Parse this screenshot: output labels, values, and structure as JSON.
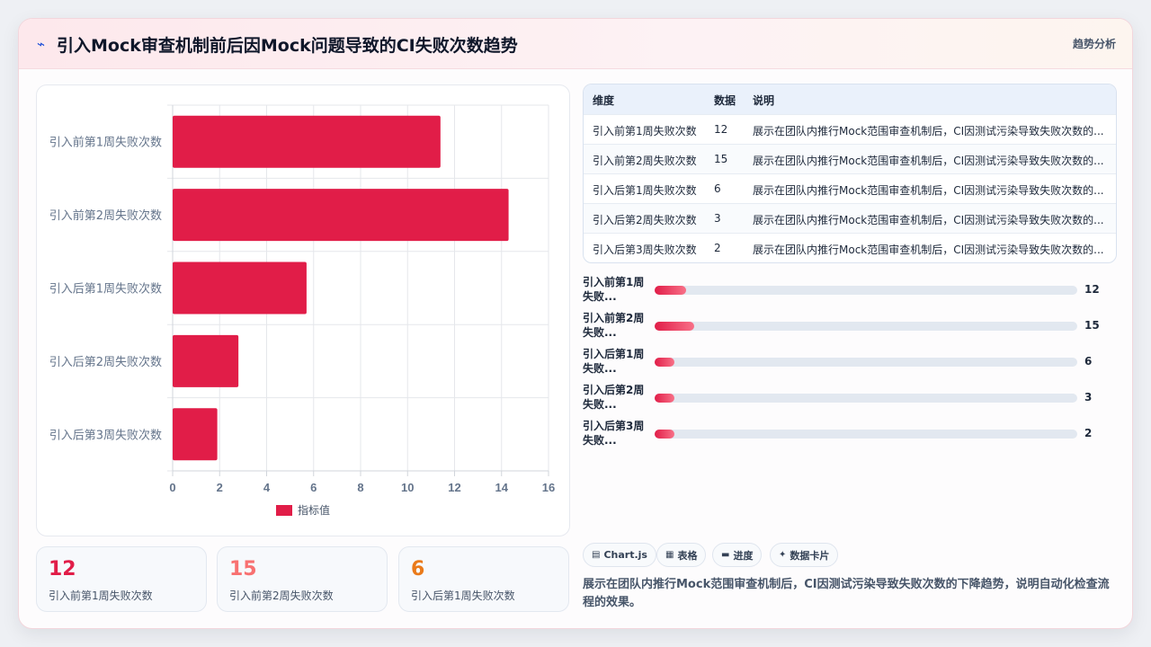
{
  "header": {
    "icon": "line-chart-icon",
    "title": "引入Mock审查机制前后因Mock问题导致的CI失败次数趋势",
    "link": "趋势分析"
  },
  "colors": {
    "accent": "#e11d48",
    "stat1": "#e11d48",
    "stat2": "#f87171",
    "stat3": "#ea7a1a"
  },
  "chart_data": {
    "type": "bar",
    "orientation": "horizontal",
    "categories": [
      "引入前第1周失败次数",
      "引入前第2周失败次数",
      "引入后第1周失败次数",
      "引入后第2周失败次数",
      "引入后第3周失败次数"
    ],
    "series": [
      {
        "name": "指标值",
        "values": [
          11.4,
          14.3,
          5.7,
          2.8,
          1.9
        ],
        "color": "#e11d48"
      }
    ],
    "xlim": [
      0,
      16
    ],
    "xticks": [
      "0",
      "2",
      "4",
      "6",
      "8",
      "10",
      "12",
      "14",
      "16"
    ],
    "grid": true,
    "legend": "bottom"
  },
  "stats": [
    {
      "value": "12",
      "label": "引入前第1周失败次数"
    },
    {
      "value": "15",
      "label": "引入前第2周失败次数"
    },
    {
      "value": "6",
      "label": "引入后第1周失败次数"
    }
  ],
  "table": {
    "headers": [
      "维度",
      "数据",
      "说明"
    ],
    "rows": [
      {
        "dim": "引入前第1周失败次数",
        "value": "12",
        "note": "展示在团队内推行Mock范围审查机制后，CI因测试污染导致失败次数的..."
      },
      {
        "dim": "引入前第2周失败次数",
        "value": "15",
        "note": "展示在团队内推行Mock范围审查机制后，CI因测试污染导致失败次数的..."
      },
      {
        "dim": "引入后第1周失败次数",
        "value": "6",
        "note": "展示在团队内推行Mock范围审查机制后，CI因测试污染导致失败次数的..."
      },
      {
        "dim": "引入后第2周失败次数",
        "value": "3",
        "note": "展示在团队内推行Mock范围审查机制后，CI因测试污染导致失败次数的..."
      },
      {
        "dim": "引入后第3周失败次数",
        "value": "2",
        "note": "展示在团队内推行Mock范围审查机制后，CI因测试污染导致失败次数的..."
      }
    ]
  },
  "progress": [
    {
      "label": "引入前第1周失败...",
      "value": "12",
      "fraction": 0.075
    },
    {
      "label": "引入前第2周失败...",
      "value": "15",
      "fraction": 0.094
    },
    {
      "label": "引入后第1周失败...",
      "value": "6",
      "fraction": 0.047
    },
    {
      "label": "引入后第2周失败...",
      "value": "3",
      "fraction": 0.047
    },
    {
      "label": "引入后第3周失败...",
      "value": "2",
      "fraction": 0.047
    }
  ],
  "tags": [
    {
      "icon": "chart-icon",
      "glyph": "▤",
      "label": "Chart.js"
    },
    {
      "icon": "table-icon",
      "glyph": "▦",
      "label": "表格"
    },
    {
      "icon": "progress-icon",
      "glyph": "▬",
      "label": "进度"
    },
    {
      "icon": "sparkle-icon",
      "glyph": "✦",
      "label": "数据卡片"
    }
  ],
  "description": "展示在团队内推行Mock范围审查机制后，CI因测试污染导致失败次数的下降趋势，说明自动化检查流程的效果。"
}
